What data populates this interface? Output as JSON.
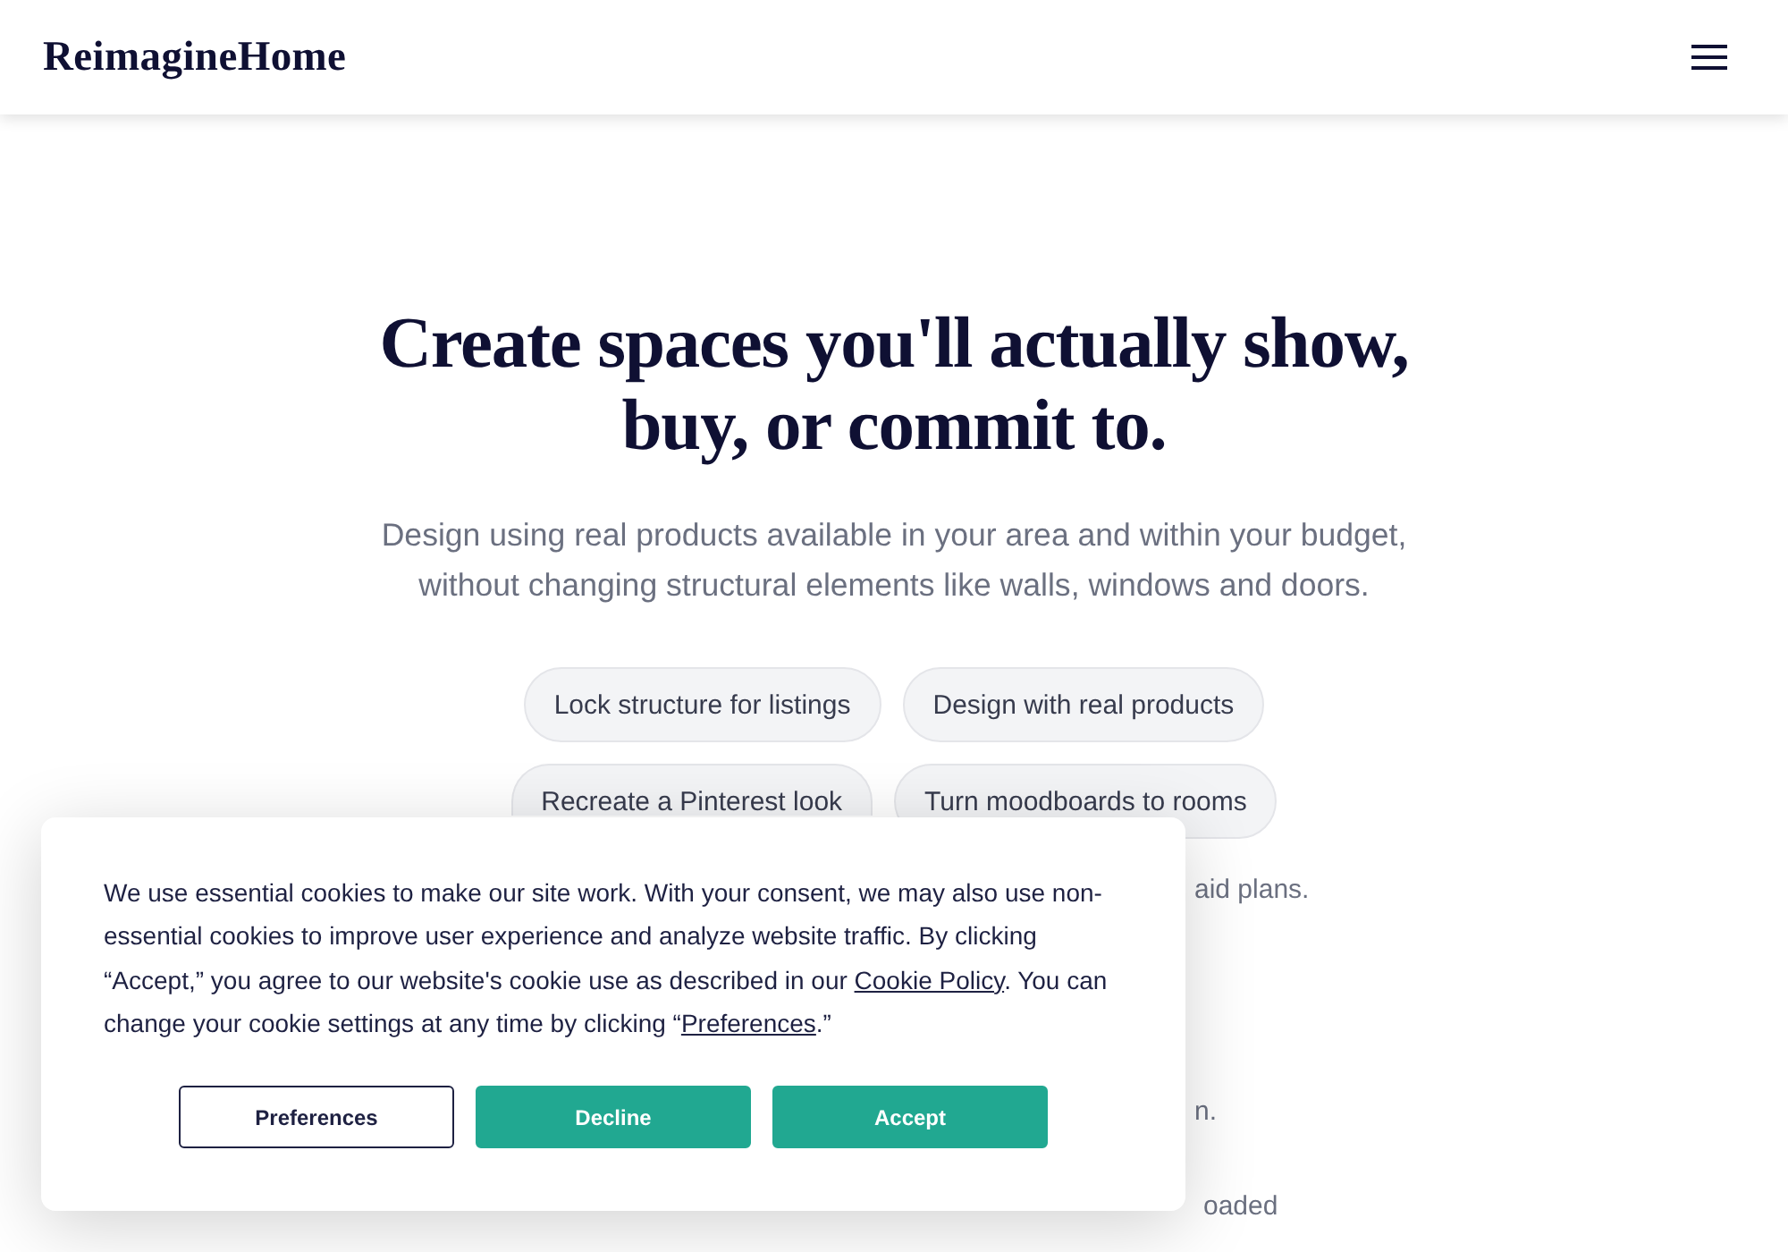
{
  "header": {
    "logo": "ReimagineHome"
  },
  "hero": {
    "title": "Create spaces you'll actually show, buy, or commit to.",
    "subtitle": "Design using real products available in your area and within your budget, without changing structural elements like walls, windows and doors.",
    "chips": [
      "Lock structure for listings",
      "Design with real products",
      "Recreate a Pinterest look",
      "Turn moodboards to rooms"
    ],
    "covered_text_fragments": [
      "aid plans.",
      "n.",
      "oaded"
    ]
  },
  "cookie_banner": {
    "message": [
      {
        "kind": "text",
        "text": "We use essential cookies to make our site work. With your consent, we may also use non-essential cookies to improve user experience and analyze website traffic. By clicking “Accept,” you agree to our website's cookie use as described in our "
      },
      {
        "kind": "link",
        "text": "Cookie Policy"
      },
      {
        "kind": "text",
        "text": ". You can change your cookie settings at any time by clicking “"
      },
      {
        "kind": "link",
        "text": "Preferences"
      },
      {
        "kind": "text",
        "text": ".”"
      }
    ],
    "buttons": [
      {
        "label": "Preferences",
        "kind": "outline"
      },
      {
        "label": "Decline",
        "kind": "filled"
      },
      {
        "label": "Accept",
        "kind": "filled"
      }
    ]
  }
}
